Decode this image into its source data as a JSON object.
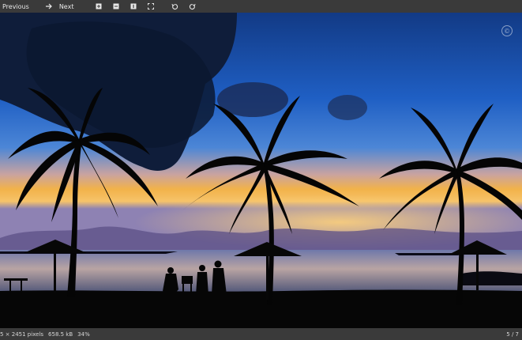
{
  "toolbar": {
    "previous_label": "Previous",
    "next_label": "Next",
    "icons": [
      "arrow-right-icon",
      "zoom-in-icon",
      "zoom-out-icon",
      "actual-size-icon",
      "fit-window-icon",
      "rotate-left-icon",
      "rotate-right-icon"
    ]
  },
  "image": {
    "watermark": "©"
  },
  "statusbar": {
    "dimensions": "5 × 2451 pixels",
    "file_size": "658.5 kB",
    "zoom": "34%",
    "position": "5 / 7"
  },
  "colors": {
    "toolbar_bg": "#3a3a3a",
    "sky_top": "#1a3f8a",
    "horizon_glow": "#f2b24a"
  }
}
